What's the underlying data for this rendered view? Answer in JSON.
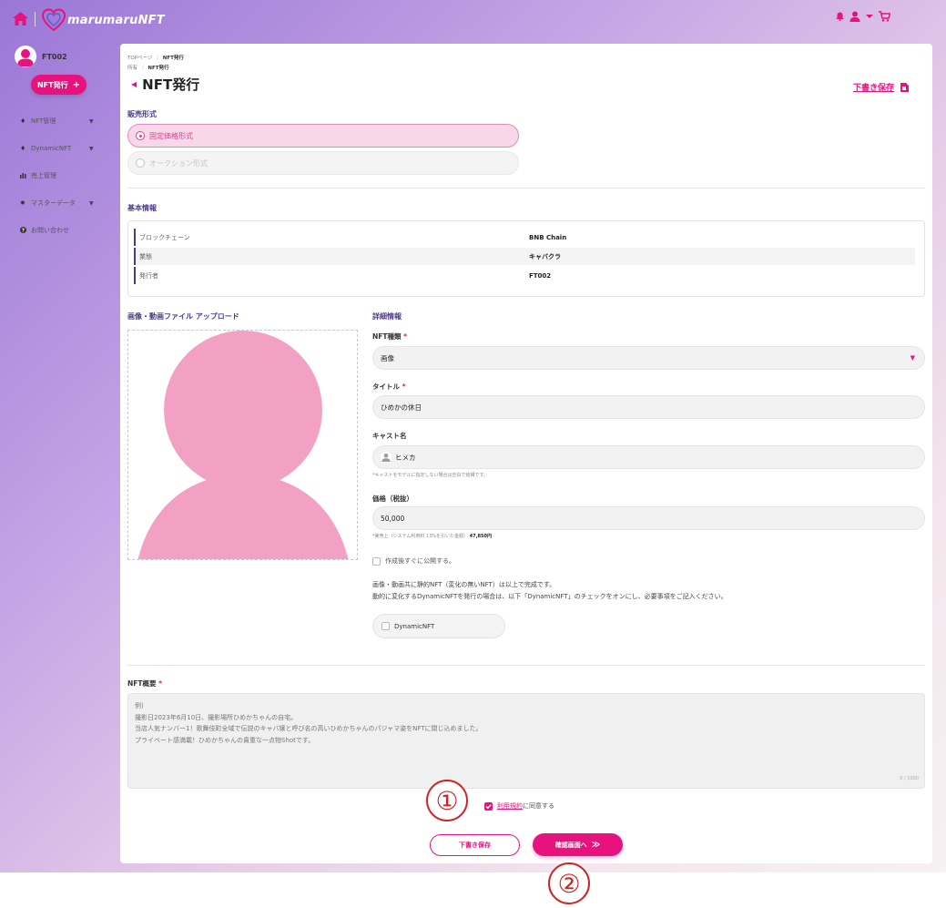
{
  "header": {
    "logo_text": "marumaruNFT",
    "icons": [
      "home-icon",
      "bell-icon",
      "user-icon",
      "chevron-down-icon",
      "cart-icon"
    ]
  },
  "sidebar": {
    "username": "FT002",
    "issue_button": "NFT発行",
    "issue_button_icon": "+",
    "items": [
      {
        "label": "NFT管理",
        "icon": "diamond-icon",
        "has_caret": true
      },
      {
        "label": "DynamicNFT",
        "icon": "diamond-icon",
        "has_caret": true
      },
      {
        "label": "売上管理",
        "icon": "chart-icon",
        "has_caret": false
      },
      {
        "label": "マスターデータ",
        "icon": "gear-icon",
        "has_caret": true
      },
      {
        "label": "お問い合わせ",
        "icon": "question-icon",
        "has_caret": false
      }
    ]
  },
  "breadcrumb": {
    "line1_first": "TOPページ",
    "line1_sep": "/",
    "line1_current": "NFT発行",
    "line2_first": "所有",
    "line2_sep": "/",
    "line2_current": "NFT発行"
  },
  "page": {
    "title": "NFT発行",
    "draft_save_link": "下書き保存"
  },
  "sales_format": {
    "title": "販売形式",
    "options": [
      {
        "label": "固定価格形式",
        "selected": true,
        "disabled": false
      },
      {
        "label": "オークション形式",
        "selected": false,
        "disabled": true
      }
    ]
  },
  "basic_info": {
    "title": "基本情報",
    "rows": [
      {
        "key": "ブロックチェーン",
        "value": "BNB Chain"
      },
      {
        "key": "業態",
        "value": "キャバクラ"
      },
      {
        "key": "発行者",
        "value": "FT002"
      }
    ]
  },
  "upload": {
    "title": "画像・動画ファイル アップロード"
  },
  "details": {
    "title": "詳細情報",
    "nft_type": {
      "label": "NFT種類",
      "value": "画像"
    },
    "title_field": {
      "label": "タイトル",
      "value": "ひめかの休日"
    },
    "cast_name": {
      "label": "キャスト名",
      "value": "ヒメカ",
      "note": "*キャストをモデルに指定しない場合は空白で結構です。"
    },
    "price": {
      "label": "価格（税抜）",
      "value": "50,000",
      "note_prefix": "*実売上（システム利用料 13%を引いた金額）",
      "note_amount": "47,850円"
    },
    "required_mark": "*",
    "publish_label": "作成後すぐに公開する。",
    "para1": "画像・動画共に静的NFT（変化の無いNFT）は以上で完成です。",
    "para2": "動的に変化するDynamicNFTを発行の場合は、以下「DynamicNFT」のチェックをオンにし、必要事項をご記入ください。",
    "dynamic_label": "DynamicNFT"
  },
  "overview": {
    "label": "NFT概要",
    "placeholder_lines": [
      "例)",
      "撮影日2023年6月10日、撮影場所ひめかちゃんの自宅。",
      "当店人気ナンバー1！歌舞伎町全域で伝説のキャバ嬢と呼び名の高いひめかちゃんのパジャマ姿をNFTに閉じ込めました。",
      "プライベート感満載！ひめかちゃんの貴重な一点物Shotです。"
    ],
    "counter": "0 / 1000"
  },
  "agreement": {
    "link_text": "利用規約",
    "suffix": "に同意する",
    "checked": true
  },
  "buttons": {
    "draft": "下書き保存",
    "confirm": "確認画面へ",
    "confirm_icon": "≫"
  },
  "annotations": {
    "marker1": "①",
    "marker2": "②"
  },
  "colors": {
    "accent": "#e8127f",
    "section_title": "#4e3a8c",
    "marker": "#cc2525",
    "placeholder_image": "#f2a1c4"
  }
}
